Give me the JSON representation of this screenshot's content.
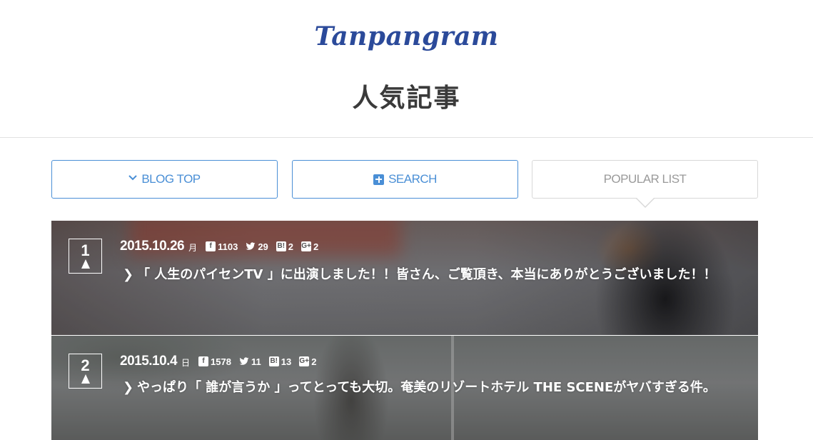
{
  "header": {
    "logo": "Tanpangram",
    "title": "人気記事"
  },
  "nav": {
    "blog_top": "BLOG TOP",
    "search": "SEARCH",
    "popular_list": "POPULAR LIST"
  },
  "articles": [
    {
      "rank": "1",
      "date": "2015.10.26",
      "dow": "月",
      "facebook": "1103",
      "twitter": "29",
      "hatena": "2",
      "gplus": "2",
      "title": "「 人生のパイセンTV 」に出演しました！！皆さん、ご覧頂き、本当にありがとうございました！！"
    },
    {
      "rank": "2",
      "date": "2015.10.4",
      "dow": "日",
      "facebook": "1578",
      "twitter": "11",
      "hatena": "13",
      "gplus": "2",
      "title": "やっぱり「 誰が言うか 」ってとっても大切。奄美のリゾートホテル THE SCENEがヤバすぎる件。"
    }
  ],
  "icons": {
    "chevron": "chevron-down-icon",
    "plus": "plus-icon",
    "facebook": "facebook-icon",
    "twitter": "twitter-icon",
    "hatena": "hatena-icon",
    "gplus": "google-plus-icon"
  },
  "colors": {
    "brand": "#2b4a9a",
    "accent": "#4a8fd6",
    "inactive": "#9a9a9a"
  }
}
